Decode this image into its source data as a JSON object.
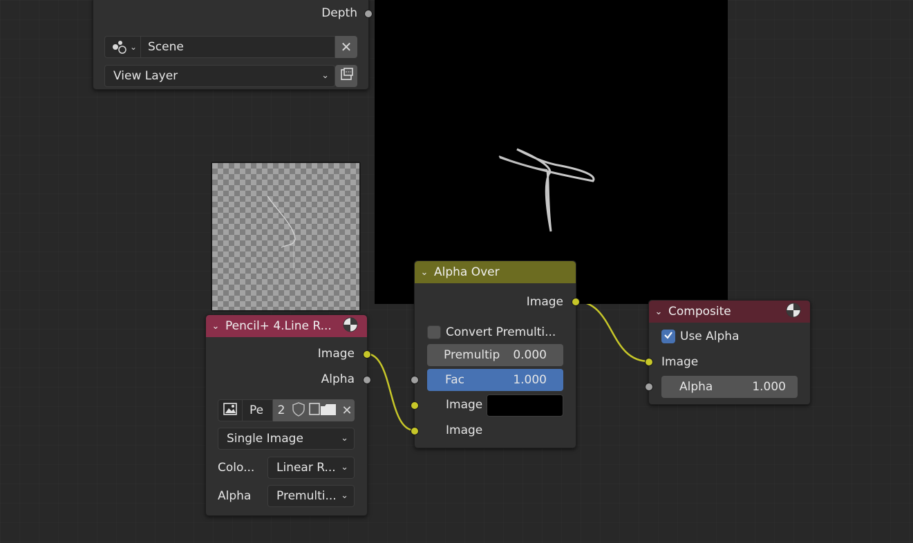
{
  "render_layers_node": {
    "depth_label": "Depth",
    "scene_value": "Scene",
    "view_layer_value": "View Layer"
  },
  "image_node": {
    "title": "Pencil+ 4.Line R...",
    "out_image_label": "Image",
    "out_alpha_label": "Alpha",
    "image_name": "Pe",
    "user_count": "2",
    "source_value": "Single Image",
    "color_label": "Colo...",
    "color_value": "Linear R...",
    "alpha_label": "Alpha",
    "alpha_value": "Premulti..."
  },
  "alpha_over_node": {
    "title": "Alpha Over",
    "out_image_label": "Image",
    "convert_label": "Convert Premulti...",
    "premultiply_label": "Premultip",
    "premultiply_value": "0.000",
    "fac_label": "Fac",
    "fac_value": "1.000",
    "fac_fraction": 1.0,
    "in_image1_label": "Image",
    "in_image2_label": "Image",
    "color_swatch": "#000000"
  },
  "composite_node": {
    "title": "Composite",
    "use_alpha_label": "Use Alpha",
    "use_alpha_checked": true,
    "in_image_label": "Image",
    "alpha_label": "Alpha",
    "alpha_value": "1.000"
  },
  "colors": {
    "canvas_bg": "#282828",
    "node_body": "#303030",
    "image_header": "#8a2f4a",
    "alpha_over_header": "#6c6c21",
    "composite_header": "#5a2430",
    "socket_color": "#c7c729",
    "socket_value": "#a1a1a1",
    "accent_blue": "#4772b3"
  },
  "icons": {
    "sep": "node-separator-icon",
    "close": "close-x-icon",
    "view_layer": "render-icon",
    "image": "image-icon",
    "fake_user": "shield-icon",
    "open": "folder-icon",
    "render": "render-result-icon"
  }
}
